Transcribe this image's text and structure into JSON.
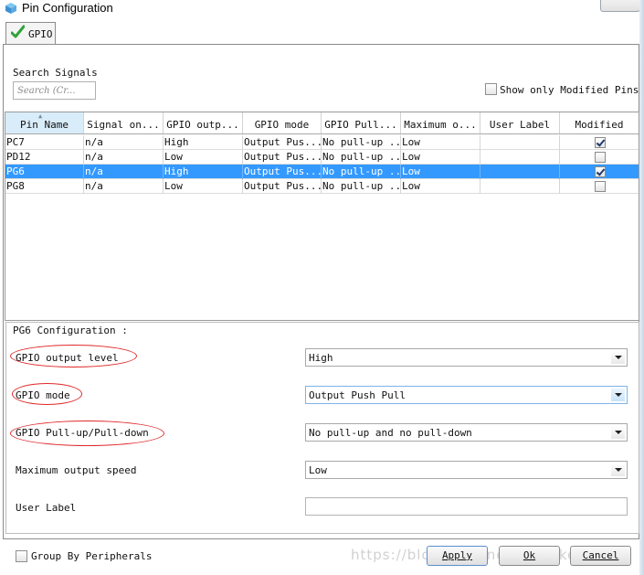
{
  "window": {
    "title": "Pin Configuration"
  },
  "tabs": [
    {
      "label": "GPIO"
    }
  ],
  "search": {
    "label": "Search Signals",
    "placeholder": "Search (Cr..."
  },
  "show_only_modified": {
    "label": "Show only Modified Pins",
    "checked": false
  },
  "table": {
    "columns": [
      "Pin Name",
      "Signal on...",
      "GPIO outp...",
      "GPIO mode",
      "GPIO Pull...",
      "Maximum o...",
      "User Label",
      "Modified"
    ],
    "sorted_column": "Pin Name",
    "rows": [
      {
        "pin": "PC7",
        "signal": "n/a",
        "output_level": "High",
        "mode": "Output Pus...",
        "pull": "No pull-up ...",
        "speed": "Low",
        "label": "",
        "modified": true
      },
      {
        "pin": "PD12",
        "signal": "n/a",
        "output_level": "Low",
        "mode": "Output Pus...",
        "pull": "No pull-up ...",
        "speed": "Low",
        "label": "",
        "modified": false
      },
      {
        "pin": "PG6",
        "signal": "n/a",
        "output_level": "High",
        "mode": "Output Pus...",
        "pull": "No pull-up ...",
        "speed": "Low",
        "label": "",
        "modified": true
      },
      {
        "pin": "PG8",
        "signal": "n/a",
        "output_level": "Low",
        "mode": "Output Pus...",
        "pull": "No pull-up ...",
        "speed": "Low",
        "label": "",
        "modified": false
      }
    ],
    "selected_row": "PG6"
  },
  "config": {
    "title": "PG6 Configuration :",
    "fields": [
      {
        "label": "GPIO output level",
        "value": "High"
      },
      {
        "label": "GPIO mode",
        "value": "Output Push Pull"
      },
      {
        "label": "GPIO Pull-up/Pull-down",
        "value": "No pull-up and no pull-down"
      },
      {
        "label": "Maximum output speed",
        "value": "Low"
      },
      {
        "label": "User Label",
        "value": ""
      }
    ]
  },
  "footer": {
    "group_by_label": "Group By Peripherals",
    "group_by_checked": false,
    "apply_label": "Apply",
    "ok_label": "Ok",
    "cancel_label": "Cancel",
    "watermark": "https://blog.csdn.net/Forsaken"
  },
  "colors": {
    "selection": "#3399ff",
    "annotation": "#e0282a",
    "check": "#2fa23a"
  }
}
